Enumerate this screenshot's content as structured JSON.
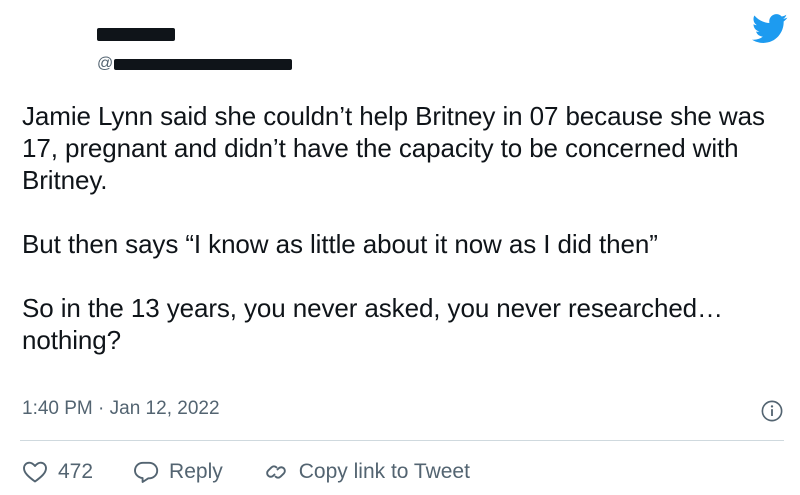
{
  "author": {
    "handle_prefix": "@"
  },
  "tweet": {
    "paragraphs": [
      "Jamie Lynn said she couldn’t help Britney in 07 because she was 17, pregnant and didn’t have the capacity to be concerned with Britney.",
      "But then says “I know as little about it now as I did then”",
      "So in the 13 years, you never asked, you never researched… nothing?"
    ],
    "timestamp": "1:40 PM · Jan 12, 2022"
  },
  "actions": {
    "like_count": "472",
    "reply_label": "Reply",
    "copy_link_label": "Copy link to Tweet"
  },
  "icons": {
    "brand": "twitter-bird-icon",
    "info": "info-icon",
    "like": "heart-icon",
    "reply": "speech-bubble-icon",
    "copy": "link-icon"
  },
  "colors": {
    "twitter_blue": "#1d9bf0",
    "text": "#0f1419",
    "secondary": "#536471",
    "divider": "#cfd9de"
  }
}
